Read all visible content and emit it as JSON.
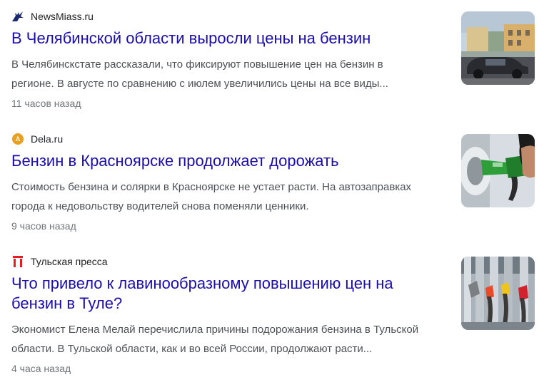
{
  "items": [
    {
      "source": "NewsMiass.ru",
      "source_icon": "wolf-icon",
      "title": "В Челябинской области выросли цены на бензин",
      "snippet_lines": [
        "В Челябинскстате рассказали, что фиксируют повышение цен на бензин в",
        "регионе. В августе по сравнению с июлем увеличились цены на все виды..."
      ],
      "time": "11 часов назад",
      "thumbnail": "street-with-car-thumbnail"
    },
    {
      "source": "Dela.ru",
      "source_icon": "dela-logo-icon",
      "title": "Бензин в Красноярске продолжает дорожать",
      "snippet_lines": [
        "Стоимость бензина и солярки в Красноярске не устает расти. На автозаправках",
        "города к недовольству водителей снова поменяли ценники."
      ],
      "time": "9 часов назад",
      "thumbnail": "fuel-nozzle-thumbnail"
    },
    {
      "source": "Тульская пресса",
      "source_icon": "tula-press-logo-icon",
      "title_lines": [
        "Что привело к лавинообразному повышению цен на",
        "бензин в Туле?"
      ],
      "snippet_lines": [
        "Экономист Елена Мелай перечислила причины подорожания бензина в Тульской",
        "области. В Тульской области, как и во всей России, продолжают расти..."
      ],
      "time": "4 часа назад",
      "thumbnail": "fuel-pumps-thumbnail"
    }
  ],
  "colors": {
    "title": "#1a0dab",
    "snippet": "#4d5156",
    "time": "#70757a",
    "dela_logo": "#e8a021",
    "tula_logo": "#e31e24",
    "wolf_icon": "#1a2a6c"
  }
}
